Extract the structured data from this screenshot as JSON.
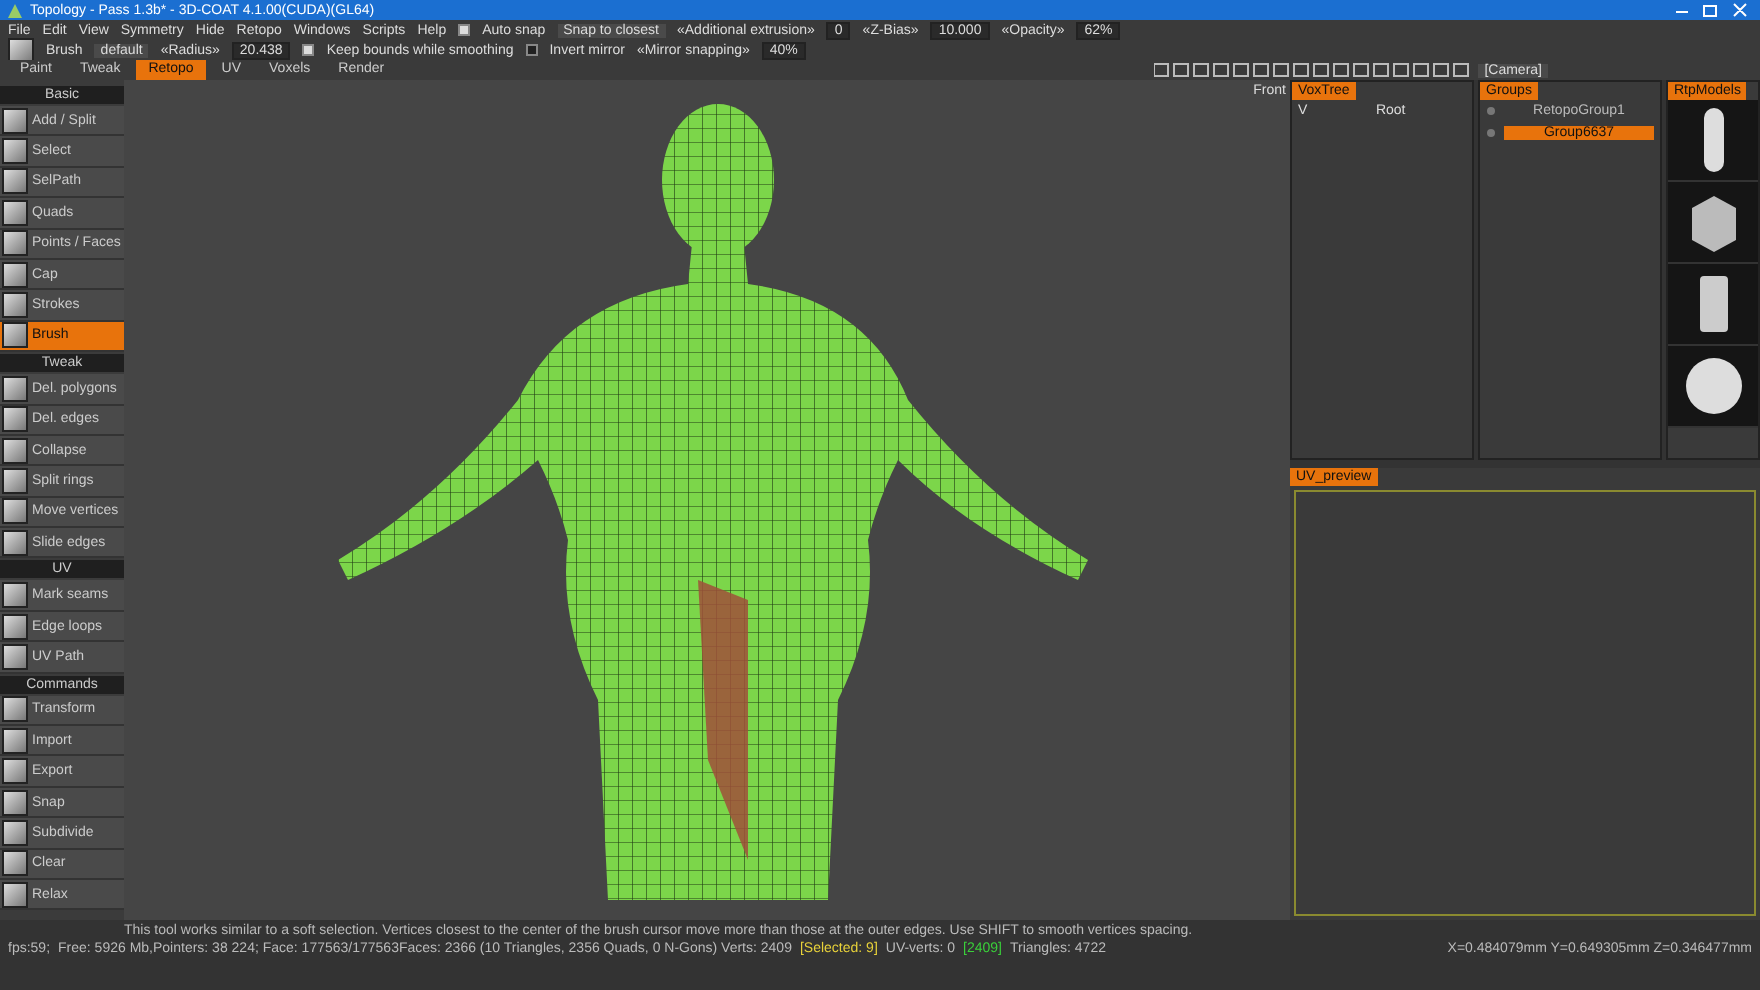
{
  "window": {
    "title": "Topology - Pass 1.3b* - 3D-COAT 4.1.00(CUDA)(GL64)"
  },
  "menu": [
    "File",
    "Edit",
    "View",
    "Symmetry",
    "Hide",
    "Retopo",
    "Windows",
    "Scripts",
    "Help"
  ],
  "menu_options": {
    "auto_snap": {
      "label": "Auto snap",
      "checked": true
    },
    "snap_mode": "Snap to closest",
    "extrusion": {
      "label": "«Additional extrusion»",
      "value": "0"
    },
    "zbias": {
      "label": "«Z-Bias»",
      "value": "10.000"
    },
    "opacity": {
      "label": "«Opacity»",
      "value": "62%"
    }
  },
  "tool_options": {
    "tool": "Brush",
    "preset": "default",
    "radius": {
      "label": "«Radius»",
      "value": "20.438"
    },
    "keep_bounds": {
      "label": "Keep bounds while smoothing",
      "checked": true
    },
    "invert_mirror": {
      "label": "Invert mirror",
      "checked": false
    },
    "mirror_snapping": {
      "label": "«Mirror snapping»",
      "value": "40%"
    }
  },
  "tabs": [
    {
      "label": "Paint",
      "selected": false
    },
    {
      "label": "Tweak",
      "selected": false
    },
    {
      "label": "Retopo",
      "selected": true
    },
    {
      "label": "UV",
      "selected": false
    },
    {
      "label": "Voxels",
      "selected": false
    },
    {
      "label": "Render",
      "selected": false
    }
  ],
  "camera": "[Camera]",
  "view_label": "Front",
  "tool_sections": [
    {
      "title": "Basic",
      "tools": [
        {
          "label": "Add / Split",
          "selected": false
        },
        {
          "label": "Select",
          "selected": false
        },
        {
          "label": "SelPath",
          "selected": false
        },
        {
          "label": "Quads",
          "selected": false
        },
        {
          "label": "Points / Faces",
          "selected": false
        },
        {
          "label": "Cap",
          "selected": false
        },
        {
          "label": "Strokes",
          "selected": false
        },
        {
          "label": "Brush",
          "selected": true
        }
      ]
    },
    {
      "title": "Tweak",
      "tools": [
        {
          "label": "Del. polygons",
          "selected": false
        },
        {
          "label": "Del. edges",
          "selected": false
        },
        {
          "label": "Collapse",
          "selected": false
        },
        {
          "label": "Split rings",
          "selected": false
        },
        {
          "label": "Move vertices",
          "selected": false
        },
        {
          "label": "Slide edges",
          "selected": false
        }
      ]
    },
    {
      "title": "UV",
      "tools": [
        {
          "label": "Mark seams",
          "selected": false
        },
        {
          "label": "Edge loops",
          "selected": false
        },
        {
          "label": "UV Path",
          "selected": false
        }
      ]
    },
    {
      "title": "Commands",
      "tools": [
        {
          "label": "Transform",
          "selected": false
        },
        {
          "label": "Import",
          "selected": false
        },
        {
          "label": "Export",
          "selected": false
        },
        {
          "label": "Snap",
          "selected": false
        },
        {
          "label": "Subdivide",
          "selected": false
        },
        {
          "label": "Clear",
          "selected": false
        },
        {
          "label": "Relax",
          "selected": false
        }
      ]
    }
  ],
  "voxtree": {
    "title": "VoxTree",
    "visibility": "V",
    "root": "Root"
  },
  "groups": {
    "title": "Groups",
    "items": [
      {
        "label": "RetopoGroup1",
        "selected": false
      },
      {
        "label": "Group6637",
        "selected": true
      }
    ]
  },
  "rtp_models": {
    "title": "RtpModels"
  },
  "uv_preview": {
    "title": "UV_preview"
  },
  "hint": "This tool works similar to a soft selection. Vertices closest to the center of the brush cursor move more than those at the outer edges. Use SHIFT to smooth vertices spacing.",
  "status": [
    {
      "kind": "plain",
      "text": "fps:59;"
    },
    {
      "kind": "plain",
      "text": "Free: 5926 Mb,Pointers: 38 224; Face: 177563/177563Faces: 2366 (10 Triangles, 2356 Quads, 0 N-Gons) Verts: 2409"
    },
    {
      "kind": "selected",
      "text": "[Selected: 9]"
    },
    {
      "kind": "plain",
      "text": "UV-verts: 0"
    },
    {
      "kind": "uv",
      "text": "[2409]"
    },
    {
      "kind": "plain",
      "text": "Triangles: 4722"
    }
  ],
  "coords": "X=0.484079mm Y=0.649305mm Z=0.346477mm"
}
